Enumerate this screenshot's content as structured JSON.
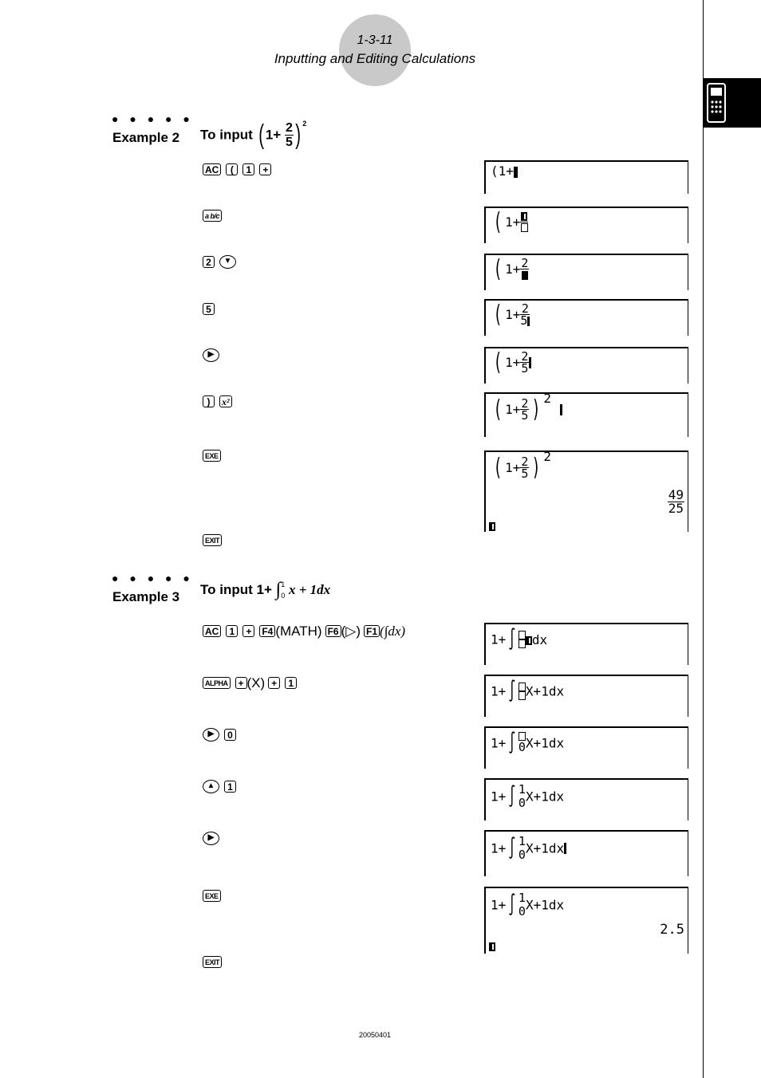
{
  "header": {
    "page_number": "1-3-11",
    "title": "Inputting and Editing Calculations"
  },
  "side_tab": {
    "icon": "calculator-icon"
  },
  "examples": [
    {
      "dots": "● ● ● ● ●",
      "label": "Example 2",
      "to_input": "To input",
      "expression": {
        "open": "(",
        "base": "1+",
        "num": "2",
        "den": "5",
        "close": ")",
        "exp": "2"
      },
      "steps": [
        {
          "keys": [
            "AC",
            "(",
            "1",
            "+"
          ],
          "screen": {
            "text": "(1+",
            "cursor": "bar"
          }
        },
        {
          "keys": [
            "a b/c"
          ],
          "screen": {
            "text": "(1+□/□",
            "cursor": "numerator"
          }
        },
        {
          "keys": [
            "2",
            "▼"
          ],
          "screen": {
            "text": "(1+2/□",
            "cursor": "denominator"
          }
        },
        {
          "keys": [
            "5"
          ],
          "screen": {
            "text": "(1+2/5",
            "cursor": "after-den"
          }
        },
        {
          "keys": [
            "▶"
          ],
          "screen": {
            "text": "(1+2/5",
            "cursor": "bar"
          }
        },
        {
          "keys": [
            ")",
            "x²"
          ],
          "screen": {
            "text": "(1+2/5)^2",
            "cursor": "bar"
          }
        },
        {
          "keys": [
            "EXE"
          ],
          "screen": {
            "text": "(1+2/5)^2",
            "result_num": "49",
            "result_den": "25"
          }
        },
        {
          "keys": [
            "EXIT"
          ]
        }
      ]
    },
    {
      "dots": "● ● ● ● ●",
      "label": "Example 3",
      "to_input": "To input",
      "expression": {
        "prefix": "1+",
        "integral": "∫",
        "upper": "1",
        "lower": "0",
        "body": "x + 1",
        "dx": "dx"
      },
      "steps": [
        {
          "keys": [
            "AC",
            "1",
            "+",
            "F4"
          ],
          "notes": [
            "(MATH)",
            "(▷)",
            "(∫dx)"
          ],
          "keys_b": [
            "F6",
            "F1"
          ],
          "screen": {
            "prefix": "1+",
            "upper": "□",
            "lower": "□",
            "body": "□dx"
          }
        },
        {
          "keys": [
            "ALPHA",
            "+"
          ],
          "note": "(X)",
          "keys_b": [
            "+",
            "1"
          ],
          "screen": {
            "prefix": "1+",
            "upper": "□",
            "lower": "□",
            "body": "X+1dx"
          }
        },
        {
          "keys": [
            "▶",
            "0"
          ],
          "screen": {
            "prefix": "1+",
            "upper": "□",
            "lower": "0",
            "body": "X+1dx"
          }
        },
        {
          "keys": [
            "▲",
            "1"
          ],
          "screen": {
            "prefix": "1+",
            "upper": "1",
            "lower": "0",
            "body": "X+1dx"
          }
        },
        {
          "keys": [
            "▶"
          ],
          "screen": {
            "prefix": "1+",
            "upper": "1",
            "lower": "0",
            "body": "X+1dx"
          }
        },
        {
          "keys": [
            "EXE"
          ],
          "screen": {
            "prefix": "1+",
            "upper": "1",
            "lower": "0",
            "body": "X+1dx",
            "result": "2.5"
          }
        },
        {
          "keys": [
            "EXIT"
          ]
        }
      ]
    }
  ],
  "footer": {
    "code": "20050401"
  }
}
